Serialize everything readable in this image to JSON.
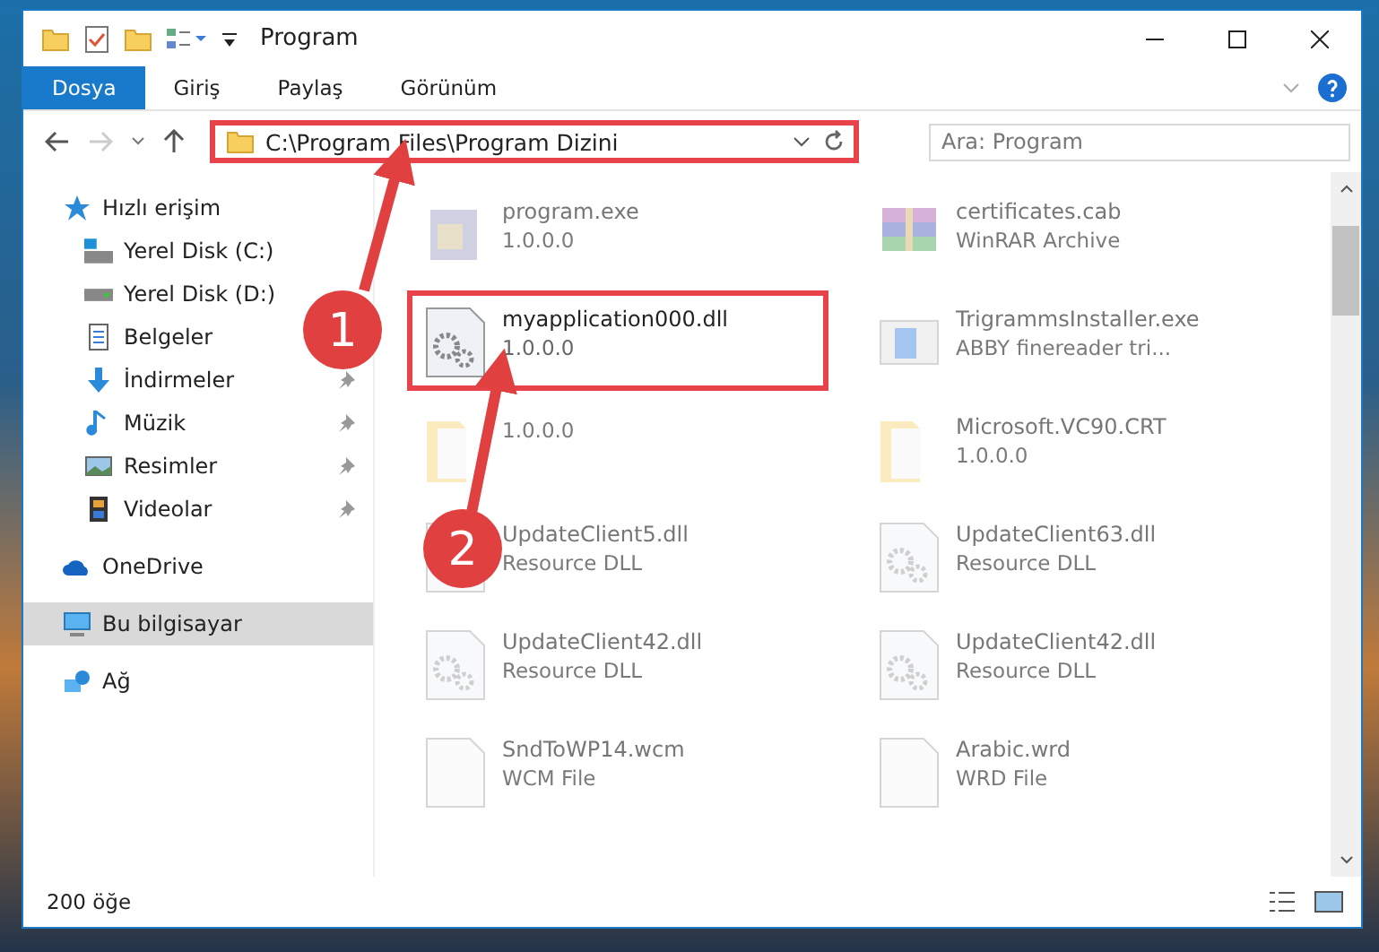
{
  "window": {
    "title": "Program"
  },
  "ribbon_tabs": [
    {
      "label": "Dosya",
      "selected": true
    },
    {
      "label": "Giriş",
      "selected": false
    },
    {
      "label": "Paylaş",
      "selected": false
    },
    {
      "label": "Görünüm",
      "selected": false
    }
  ],
  "address_bar": {
    "path": "C:\\Program Files\\Program Dizini",
    "highlighted": true
  },
  "search": {
    "placeholder": "Ara: Program"
  },
  "sidebar": {
    "items": [
      {
        "label": "Hızlı erişim",
        "kind": "star",
        "selected": false,
        "children": [
          {
            "label": "Yerel Disk (C:)",
            "kind": "system-drive",
            "pinned": false,
            "selected": false
          },
          {
            "label": "Yerel Disk (D:)",
            "kind": "drive",
            "pinned": false,
            "selected": false
          },
          {
            "label": "Belgeler",
            "kind": "document",
            "pinned": false,
            "selected": false
          },
          {
            "label": "İndirmeler",
            "kind": "download",
            "pinned": true,
            "selected": false
          },
          {
            "label": "Müzik",
            "kind": "music",
            "pinned": true,
            "selected": false
          },
          {
            "label": "Resimler",
            "kind": "picture",
            "pinned": true,
            "selected": false
          },
          {
            "label": "Videolar",
            "kind": "video",
            "pinned": true,
            "selected": false
          }
        ]
      },
      {
        "label": "OneDrive",
        "kind": "cloud",
        "selected": false
      },
      {
        "label": "Bu bilgisayar",
        "kind": "computer",
        "selected": true
      },
      {
        "label": "Ağ",
        "kind": "network",
        "selected": false
      }
    ]
  },
  "files": [
    {
      "name": "program.exe",
      "detail": "1.0.0.0",
      "kind": "exe",
      "dimmed": true,
      "highlighted": false
    },
    {
      "name": "certificates.cab",
      "detail": "WinRAR Archive",
      "kind": "archive",
      "dimmed": true,
      "highlighted": false
    },
    {
      "name": "myapplication000.dll",
      "detail": "1.0.0.0",
      "kind": "dll",
      "dimmed": false,
      "highlighted": true
    },
    {
      "name": "TrigrammsInstaller.exe",
      "detail": "ABBY finereader tri...",
      "kind": "installer",
      "dimmed": true,
      "highlighted": false
    },
    {
      "detail": "1.0.0.0",
      "kind": "folder",
      "dimmed": true,
      "highlighted": false
    },
    {
      "name": "Microsoft.VC90.CRT",
      "detail": "1.0.0.0",
      "kind": "folder",
      "dimmed": true,
      "highlighted": false
    },
    {
      "name": "UpdateClient5.dll",
      "detail": "Resource DLL",
      "kind": "dll",
      "dimmed": true,
      "highlighted": false
    },
    {
      "name": "UpdateClient63.dll",
      "detail": "Resource DLL",
      "kind": "dll",
      "dimmed": true,
      "highlighted": false
    },
    {
      "name": "UpdateClient42.dll",
      "detail": "Resource DLL",
      "kind": "dll",
      "dimmed": true,
      "highlighted": false
    },
    {
      "name": "UpdateClient42.dll",
      "detail": "Resource DLL",
      "kind": "dll",
      "dimmed": true,
      "highlighted": false
    },
    {
      "name": "SndToWP14.wcm",
      "detail": "WCM File",
      "kind": "blank",
      "dimmed": true,
      "highlighted": false
    },
    {
      "name": "Arabic.wrd",
      "detail": "WRD File",
      "kind": "blank",
      "dimmed": true,
      "highlighted": false
    }
  ],
  "callouts": [
    {
      "number": "1"
    },
    {
      "number": "2"
    }
  ],
  "status_bar": {
    "item_count": "200 öğe"
  }
}
